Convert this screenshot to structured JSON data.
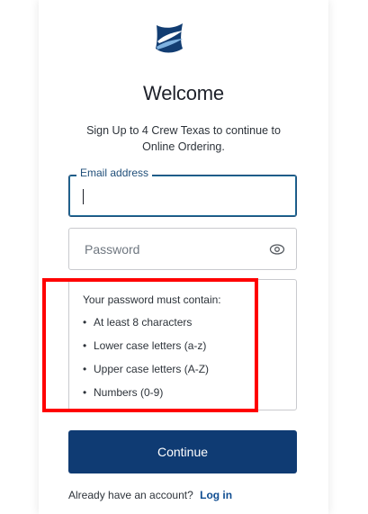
{
  "header": {
    "logo_icon": "sail-wave-logo-icon",
    "title": "Welcome",
    "subtitle": "Sign Up to 4 Crew Texas to continue to Online Ordering."
  },
  "form": {
    "email": {
      "label": "Email address",
      "value": ""
    },
    "password": {
      "placeholder": "Password",
      "toggle_icon": "eye-icon"
    },
    "requirements": {
      "title": "Your password must contain:",
      "items": [
        "At least 8 characters",
        "Lower case letters (a-z)",
        "Upper case letters (A-Z)",
        "Numbers (0-9)"
      ]
    },
    "continue_label": "Continue"
  },
  "footer": {
    "prompt": "Already have an account?",
    "login_label": "Log in"
  },
  "colors": {
    "primary": "#0f3b73",
    "link": "#0f4d91",
    "highlight": "#ff0000"
  }
}
